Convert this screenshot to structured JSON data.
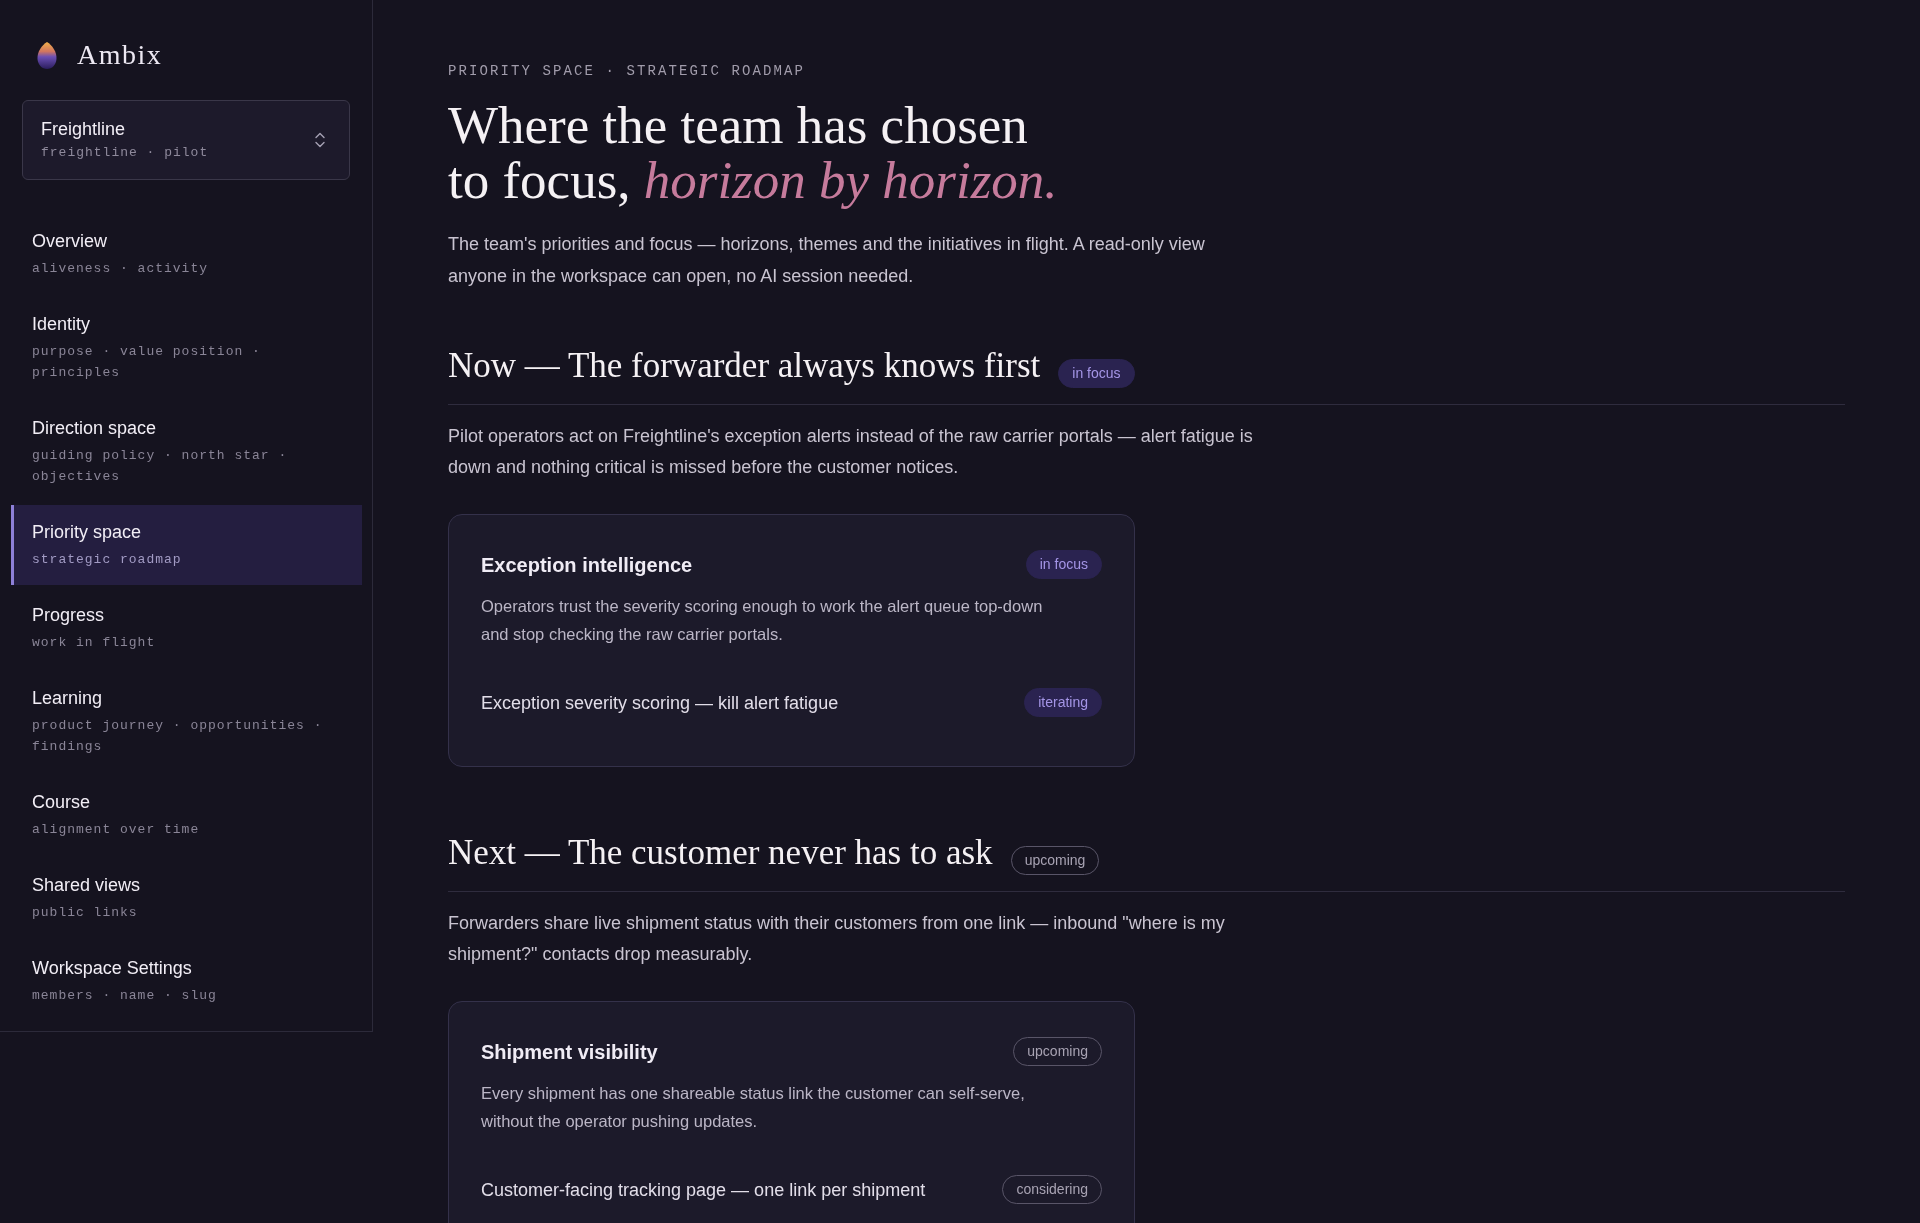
{
  "app": {
    "name": "Ambix"
  },
  "workspace": {
    "name": "Freightline",
    "detail": "freightline · pilot"
  },
  "sidebar": {
    "items": [
      {
        "label": "Overview",
        "detail": "aliveness · activity",
        "selected": false
      },
      {
        "label": "Identity",
        "detail": "purpose · value position · principles",
        "selected": false
      },
      {
        "label": "Direction space",
        "detail": "guiding policy · north star · objectives",
        "selected": false
      },
      {
        "label": "Priority space",
        "detail": "strategic roadmap",
        "selected": true
      },
      {
        "label": "Progress",
        "detail": "work in flight",
        "selected": false
      },
      {
        "label": "Learning",
        "detail": "product journey · opportunities · findings",
        "selected": false
      },
      {
        "label": "Course",
        "detail": "alignment over time",
        "selected": false
      },
      {
        "label": "Shared views",
        "detail": "public links",
        "selected": false
      },
      {
        "label": "Workspace Settings",
        "detail": "members · name · slug",
        "selected": false
      }
    ]
  },
  "page": {
    "breadcrumb": "PRIORITY SPACE · STRATEGIC ROADMAP",
    "title": "Where the team has chosen to focus, *horizon by horizon.*",
    "intro": "The team's priorities and focus — horizons, themes and the initiatives in flight. A read-only view anyone in the workspace can open, no AI session needed."
  },
  "horizons": [
    {
      "title": "Now — The forwarder always knows first",
      "status": {
        "label": "in focus",
        "kind": "active"
      },
      "description": "Pilot operators act on Freightline's exception alerts instead of the raw carrier portals — alert fatigue is down and nothing critical is missed before the customer notices.",
      "themes": [
        {
          "title": "Exception intelligence",
          "status": {
            "label": "in focus",
            "kind": "active"
          },
          "description": "Operators trust the severity scoring enough to work the alert queue top-down and stop checking the raw carrier portals.",
          "initiatives": [
            {
              "title": "Exception severity scoring — kill alert fatigue",
              "status": {
                "label": "iterating",
                "kind": "active"
              }
            }
          ]
        }
      ]
    },
    {
      "title": "Next — The customer never has to ask",
      "status": {
        "label": "upcoming",
        "kind": "planned"
      },
      "description": "Forwarders share live shipment status with their customers from one link — inbound \"where is my shipment?\" contacts drop measurably.",
      "themes": [
        {
          "title": "Shipment visibility",
          "status": {
            "label": "upcoming",
            "kind": "planned"
          },
          "description": "Every shipment has one shareable status link the customer can self-serve, without the operator pushing updates.",
          "initiatives": [
            {
              "title": "Customer-facing tracking page — one link per shipment",
              "status": {
                "label": "considering",
                "kind": "planned"
              }
            }
          ]
        }
      ]
    }
  ]
}
